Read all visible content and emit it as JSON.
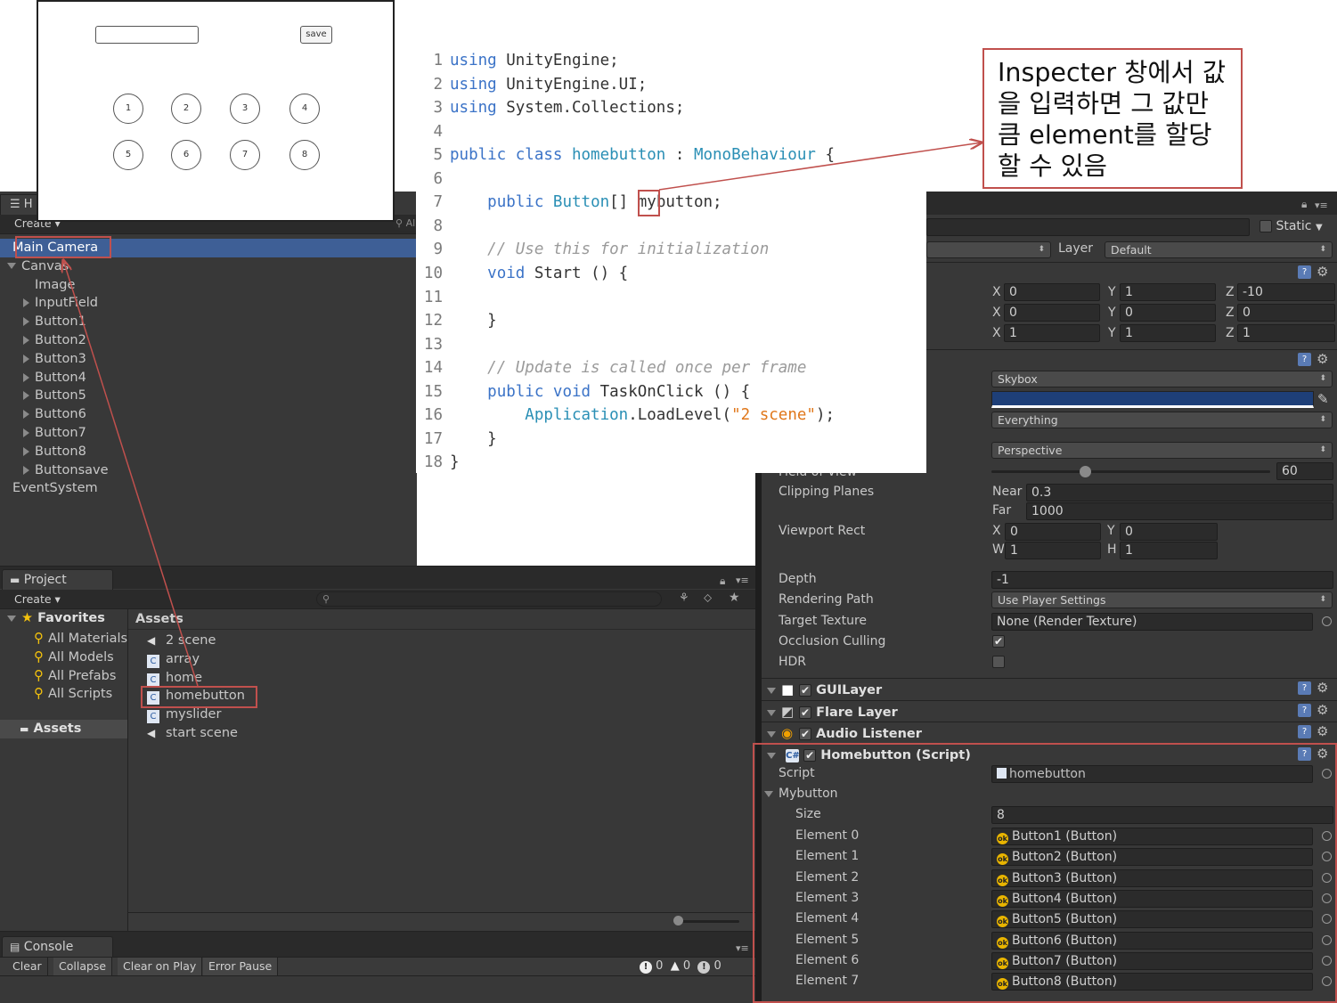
{
  "game_preview": {
    "save_label": "save",
    "buttons": [
      "1",
      "2",
      "3",
      "4",
      "5",
      "6",
      "7",
      "8"
    ]
  },
  "hierarchy": {
    "tab_label": "H",
    "create_label": "Create",
    "search_partial": "All",
    "items": [
      {
        "label": "Main Camera",
        "selected": true,
        "indent": 0,
        "expander": "none"
      },
      {
        "label": "Canvas",
        "indent": 0,
        "expander": "open"
      },
      {
        "label": "Image",
        "indent": 1,
        "expander": "none"
      },
      {
        "label": "InputField",
        "indent": 1,
        "expander": "closed"
      },
      {
        "label": "Button1",
        "indent": 1,
        "expander": "closed"
      },
      {
        "label": "Button2",
        "indent": 1,
        "expander": "closed"
      },
      {
        "label": "Button3",
        "indent": 1,
        "expander": "closed"
      },
      {
        "label": "Button4",
        "indent": 1,
        "expander": "closed"
      },
      {
        "label": "Button5",
        "indent": 1,
        "expander": "closed"
      },
      {
        "label": "Button6",
        "indent": 1,
        "expander": "closed"
      },
      {
        "label": "Button7",
        "indent": 1,
        "expander": "closed"
      },
      {
        "label": "Button8",
        "indent": 1,
        "expander": "closed"
      },
      {
        "label": "Buttonsave",
        "indent": 1,
        "expander": "closed"
      },
      {
        "label": "EventSystem",
        "indent": 0,
        "expander": "none"
      }
    ]
  },
  "project": {
    "tab_label": "Project",
    "create_label": "Create",
    "favorites_label": "Favorites",
    "favorites": [
      "All Materials",
      "All Models",
      "All Prefabs",
      "All Scripts"
    ],
    "assets_folder_label": "Assets",
    "assets_header": "Assets",
    "assets": [
      {
        "label": "2 scene",
        "icon": "unity-scene-icon"
      },
      {
        "label": "array",
        "icon": "csharp-script-icon"
      },
      {
        "label": "home",
        "icon": "csharp-script-icon"
      },
      {
        "label": "homebutton",
        "icon": "csharp-script-icon",
        "highlight": true
      },
      {
        "label": "myslider",
        "icon": "csharp-script-icon"
      },
      {
        "label": "start scene",
        "icon": "unity-scene-icon"
      }
    ]
  },
  "console": {
    "tab_label": "Console",
    "buttons": [
      "Clear",
      "Collapse",
      "Clear on Play",
      "Error Pause"
    ],
    "counts": [
      "0",
      "0",
      "0"
    ]
  },
  "code": {
    "lines": [
      {
        "n": "1",
        "parts": [
          [
            "kw",
            "using"
          ],
          [
            "pl",
            " UnityEngine;"
          ]
        ]
      },
      {
        "n": "2",
        "parts": [
          [
            "kw",
            "using"
          ],
          [
            "pl",
            " UnityEngine.UI;"
          ]
        ]
      },
      {
        "n": "3",
        "parts": [
          [
            "kw",
            "using"
          ],
          [
            "pl",
            " System.Collections;"
          ]
        ]
      },
      {
        "n": "4",
        "parts": []
      },
      {
        "n": "5",
        "parts": [
          [
            "kw",
            "public class"
          ],
          [
            "pl",
            " "
          ],
          [
            "ty",
            "homebutton"
          ],
          [
            "pl",
            " : "
          ],
          [
            "ty",
            "MonoBehaviour"
          ],
          [
            "pl",
            " {"
          ]
        ]
      },
      {
        "n": "6",
        "parts": []
      },
      {
        "n": "7",
        "parts": [
          [
            "pl",
            "    "
          ],
          [
            "kw",
            "public"
          ],
          [
            "pl",
            " "
          ],
          [
            "ty",
            "Button"
          ],
          [
            "pl",
            "[] mybutton;"
          ]
        ]
      },
      {
        "n": "8",
        "parts": []
      },
      {
        "n": "9",
        "parts": [
          [
            "pl",
            "    "
          ],
          [
            "cm",
            "// Use this for initialization"
          ]
        ]
      },
      {
        "n": "10",
        "parts": [
          [
            "pl",
            "    "
          ],
          [
            "kw",
            "void"
          ],
          [
            "pl",
            " Start () {"
          ]
        ]
      },
      {
        "n": "11",
        "parts": []
      },
      {
        "n": "12",
        "parts": [
          [
            "pl",
            "    }"
          ]
        ]
      },
      {
        "n": "13",
        "parts": []
      },
      {
        "n": "14",
        "parts": [
          [
            "pl",
            "    "
          ],
          [
            "cm",
            "// Update is called once per frame"
          ]
        ]
      },
      {
        "n": "15",
        "parts": [
          [
            "pl",
            "    "
          ],
          [
            "kw",
            "public void"
          ],
          [
            "pl",
            " TaskOnClick () {"
          ]
        ]
      },
      {
        "n": "16",
        "parts": [
          [
            "pl",
            "        "
          ],
          [
            "ty",
            "Application"
          ],
          [
            "pl",
            ".LoadLevel("
          ],
          [
            "st",
            "\"2 scene\""
          ],
          [
            "pl",
            ");"
          ]
        ]
      },
      {
        "n": "17",
        "parts": [
          [
            "pl",
            "    }"
          ]
        ]
      },
      {
        "n": "18",
        "parts": [
          [
            "pl",
            "}"
          ]
        ]
      }
    ]
  },
  "annotation": {
    "text": "Inspecter 창에서 값을 입력하면 그 값만큼 element를 할당할 수 있음"
  },
  "inspector": {
    "static_label": "Static",
    "layer_label": "Layer",
    "layer_value": "Default",
    "transform": {
      "rows": [
        {
          "x": "0",
          "y": "1",
          "z": "-10"
        },
        {
          "x": "0",
          "y": "0",
          "z": "0"
        },
        {
          "x": "1",
          "y": "1",
          "z": "1"
        }
      ]
    },
    "camera": {
      "clear_flags": "Skybox",
      "culling_mask": "Everything",
      "projection": "Perspective",
      "field_of_view_label": "Field of View",
      "field_of_view": "60",
      "clipping_planes_label": "Clipping Planes",
      "near_label": "Near",
      "near": "0.3",
      "far_label": "Far",
      "far": "1000",
      "viewport_label": "Viewport Rect",
      "viewport": {
        "x": "0",
        "y": "0",
        "w": "1",
        "h": "1"
      },
      "depth_label": "Depth",
      "depth": "-1",
      "rendering_path_label": "Rendering Path",
      "rendering_path": "Use Player Settings",
      "target_texture_label": "Target Texture",
      "target_texture": "None (Render Texture)",
      "occlusion_label": "Occlusion Culling",
      "hdr_label": "HDR",
      "bg_color": "#1e3f78"
    },
    "components": [
      "GUILayer",
      "Flare Layer",
      "Audio Listener"
    ],
    "script_component": {
      "title": "Homebutton (Script)",
      "script_label": "Script",
      "script_value": "homebutton",
      "array_label": "Mybutton",
      "size_label": "Size",
      "size": "8",
      "elements": [
        {
          "label": "Element 0",
          "value": "Button1 (Button)"
        },
        {
          "label": "Element 1",
          "value": "Button2 (Button)"
        },
        {
          "label": "Element 2",
          "value": "Button3 (Button)"
        },
        {
          "label": "Element 3",
          "value": "Button4 (Button)"
        },
        {
          "label": "Element 4",
          "value": "Button5 (Button)"
        },
        {
          "label": "Element 5",
          "value": "Button6 (Button)"
        },
        {
          "label": "Element 6",
          "value": "Button7 (Button)"
        },
        {
          "label": "Element 7",
          "value": "Button8 (Button)"
        }
      ]
    }
  },
  "colors": {
    "selection": "#3e5f96",
    "annotation_red": "#c0504d",
    "editor_bg": "#383838"
  }
}
